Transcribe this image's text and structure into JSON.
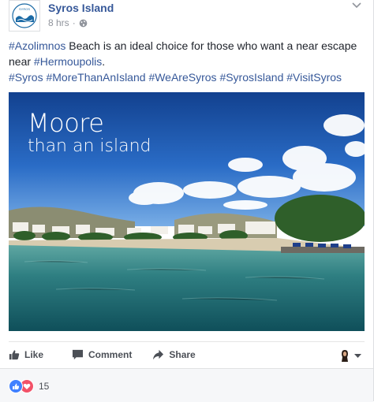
{
  "post": {
    "page_name": "Syros Island",
    "timestamp": "8 hrs",
    "separator": "·",
    "text": {
      "line1": {
        "tag": "#Azolimnos",
        "rest": " Beach is an ideal choice for those who want a near escape near "
      },
      "mention": "#Hermoupolis",
      "after_mention": ".",
      "hashtags": [
        "#Syros",
        "#MoreThanAnIsland",
        "#WeAreSyros",
        "#SyrosIsland",
        "#VisitSyros"
      ]
    },
    "image_overlay": {
      "line1": "Moore",
      "line2": "than an island"
    }
  },
  "actions": {
    "like_label": "Like",
    "comment_label": "Comment",
    "share_label": "Share"
  },
  "reactions": {
    "count": "15"
  },
  "icons": {
    "globe": "globe-icon",
    "more": "chevron-down-icon",
    "like": "thumbs-up-icon",
    "comment": "speech-bubble-icon",
    "share": "share-arrow-icon",
    "reaction_like": "like-reaction-icon",
    "reaction_love": "love-reaction-icon"
  },
  "colors": {
    "link": "#365899",
    "text": "#1d2129",
    "meta": "#90949c",
    "like_blue": "#4080ff",
    "love_red": "#f25268"
  }
}
